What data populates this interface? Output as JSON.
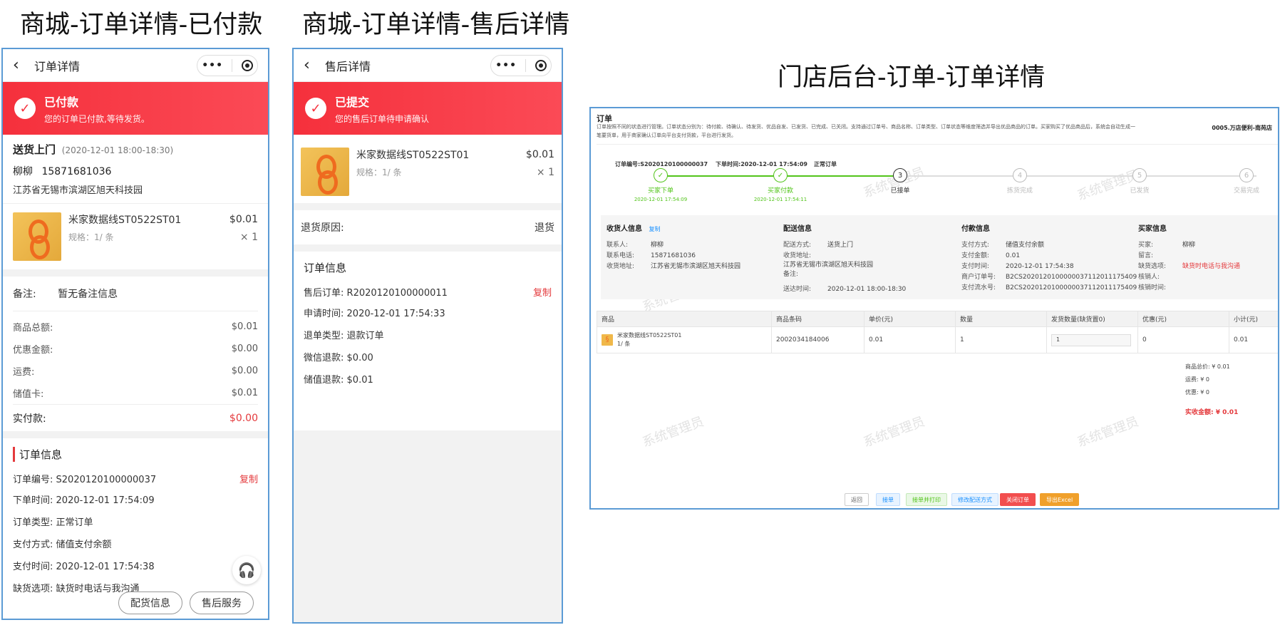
{
  "titles": {
    "paid": "商城-订单详情-已付款",
    "aftersale": "商城-订单详情-售后详情",
    "admin": "门店后台-订单-订单详情"
  },
  "paid": {
    "header_title": "订单详情",
    "status_title": "已付款",
    "status_sub": "您的订单已付款,等待发货。",
    "delivery_type": "送货上门",
    "delivery_time": "(2020-12-01 18:00-18:30)",
    "contact_name": "柳柳",
    "contact_phone": "15871681036",
    "address": "江苏省无锡市滨湖区旭天科技园",
    "product_name": "米家数据线ST0522ST01",
    "product_spec": "规格：1/ 条",
    "product_price": "$0.01",
    "product_qty": "× 1",
    "remark_label": "备注:",
    "remark_value": "暂无备注信息",
    "amounts": [
      {
        "label": "商品总额:",
        "value": "$0.01"
      },
      {
        "label": "优惠金额:",
        "value": "$0.00"
      },
      {
        "label": "运费:",
        "value": "$0.00"
      },
      {
        "label": "储值卡:",
        "value": "$0.01"
      }
    ],
    "paid_label": "实付款:",
    "paid_value": "$0.00",
    "info_title": "订单信息",
    "info": [
      {
        "label": "订单编号:",
        "value": "S2020120100000037",
        "copy": "复制"
      },
      {
        "label": "下单时间:",
        "value": "2020-12-01 17:54:09",
        "copy": ""
      },
      {
        "label": "订单类型:",
        "value": "正常订单",
        "copy": ""
      },
      {
        "label": "支付方式:",
        "value": "储值支付余额",
        "copy": ""
      },
      {
        "label": "支付时间:",
        "value": "2020-12-01 17:54:38",
        "copy": ""
      },
      {
        "label": "缺货选项:",
        "value": "缺货时电话与我沟通",
        "copy": ""
      }
    ],
    "btn_delivery": "配货信息",
    "btn_aftersale": "售后服务"
  },
  "aftersale": {
    "header_title": "售后详情",
    "status_title": "已提交",
    "status_sub": "您的售后订单待申请确认",
    "product_name": "米家数据线ST0522ST01",
    "product_spec": "规格：1/ 条",
    "product_price": "$0.01",
    "product_qty": "× 1",
    "reason_label": "退货原因:",
    "reason_value": "退货",
    "info_title": "订单信息",
    "info": [
      {
        "label": "售后订单:",
        "value": "R2020120100000011",
        "copy": "复制"
      },
      {
        "label": "申请时间:",
        "value": "2020-12-01 17:54:33",
        "copy": ""
      },
      {
        "label": "退单类型:",
        "value": "退款订单",
        "copy": ""
      },
      {
        "label": "微信退款:",
        "value": "$0.00",
        "copy": ""
      },
      {
        "label": "储值退款:",
        "value": "$0.01",
        "copy": ""
      }
    ]
  },
  "admin": {
    "page_title": "订单",
    "desc_line1": "订单按照不同的状态进行管理。订单状态分别为：待付款、待确认、待发货、优品自发、已发货、已完成、已关闭。支持通过订单号、商品名称、订单类型、订单状态等维度筛选并导出优品商品的订单。买家购买了优品商品后，系统会自动生成一",
    "desc_line2": "笔要货单，用于商家确认订单向平台支付货款，平台进行发货。",
    "store_name": "0005.万店便利-南苑店",
    "order_no": "订单编号:S2020120100000037",
    "order_time": "下单时间:2020-12-01 17:54:09",
    "order_type": "正常订单",
    "watermark": "系统管理员",
    "steps": [
      {
        "label": "买家下单",
        "time": "2020-12-01 17:54:09",
        "mark": "✓",
        "state": "done"
      },
      {
        "label": "买家付款",
        "time": "2020-12-01 17:54:11",
        "mark": "✓",
        "state": "done"
      },
      {
        "label": "已接单",
        "time": "",
        "mark": "3",
        "state": "current"
      },
      {
        "label": "拣货完成",
        "time": "",
        "mark": "4",
        "state": "todo"
      },
      {
        "label": "已发货",
        "time": "",
        "mark": "5",
        "state": "todo"
      },
      {
        "label": "交易完成",
        "time": "",
        "mark": "6",
        "state": "todo"
      }
    ],
    "receiver": {
      "title": "收货人信息",
      "copy": "复制",
      "rows": [
        {
          "k": "联系人:",
          "v": "柳柳"
        },
        {
          "k": "联系电话:",
          "v": "15871681036"
        },
        {
          "k": "收货地址:",
          "v": "江苏省无锡市滨湖区旭天科技园"
        }
      ]
    },
    "delivery": {
      "title": "配送信息",
      "rows": [
        {
          "k": "配送方式:",
          "v": "送货上门"
        },
        {
          "k": "收货地址:",
          "v": ""
        },
        {
          "k": "",
          "v": "江苏省无锡市滨湖区旭天科技园"
        },
        {
          "k": "备注:",
          "v": ""
        },
        {
          "k": "送达时间:",
          "v": "2020-12-01 18:00-18:30"
        }
      ]
    },
    "payment": {
      "title": "付款信息",
      "rows": [
        {
          "k": "支付方式:",
          "v": "储值支付余额"
        },
        {
          "k": "支付金额:",
          "v": "0.01"
        },
        {
          "k": "支付时间:",
          "v": "2020-12-01 17:54:38"
        },
        {
          "k": "商户订单号:",
          "v": "B2CS2020120100000037112011175409"
        },
        {
          "k": "支付流水号:",
          "v": "B2CS2020120100000037112011175409"
        }
      ]
    },
    "buyer": {
      "title": "买家信息",
      "rows": [
        {
          "k": "买家:",
          "v": "柳柳"
        },
        {
          "k": "留言:",
          "v": ""
        },
        {
          "k": "缺货选项:",
          "v": "缺货时电话与我沟通"
        },
        {
          "k": "核销人:",
          "v": ""
        },
        {
          "k": "核销时间:",
          "v": ""
        }
      ]
    },
    "table_headers": [
      "商品",
      "商品条码",
      "单价(元)",
      "数量",
      "发货数量(缺货置0)",
      "优惠(元)",
      "小计(元)"
    ],
    "table_row": {
      "name": "米家数据线ST0522ST01",
      "spec": "1/ 条",
      "barcode": "2002034184006",
      "price": "0.01",
      "qty": "1",
      "ship_qty": "1",
      "discount": "0",
      "subtotal": "0.01"
    },
    "summary": {
      "goods_total": "商品总价: ¥ 0.01",
      "freight": "运费: ¥ 0",
      "discount": "优惠: ¥ 0",
      "received": "实收金额: ¥ 0.01"
    },
    "buttons": {
      "back": "返回",
      "accept": "接单",
      "accept_print": "接单并打印",
      "modify_delivery": "修改配送方式",
      "close": "关闭订单",
      "export": "导出Excel"
    },
    "colors": {
      "done": "#52c41a",
      "current": "#333333",
      "todo": "#bbbbbb",
      "danger": "#e4393c",
      "warning": "#f0a02b",
      "link": "#1890ff"
    }
  }
}
